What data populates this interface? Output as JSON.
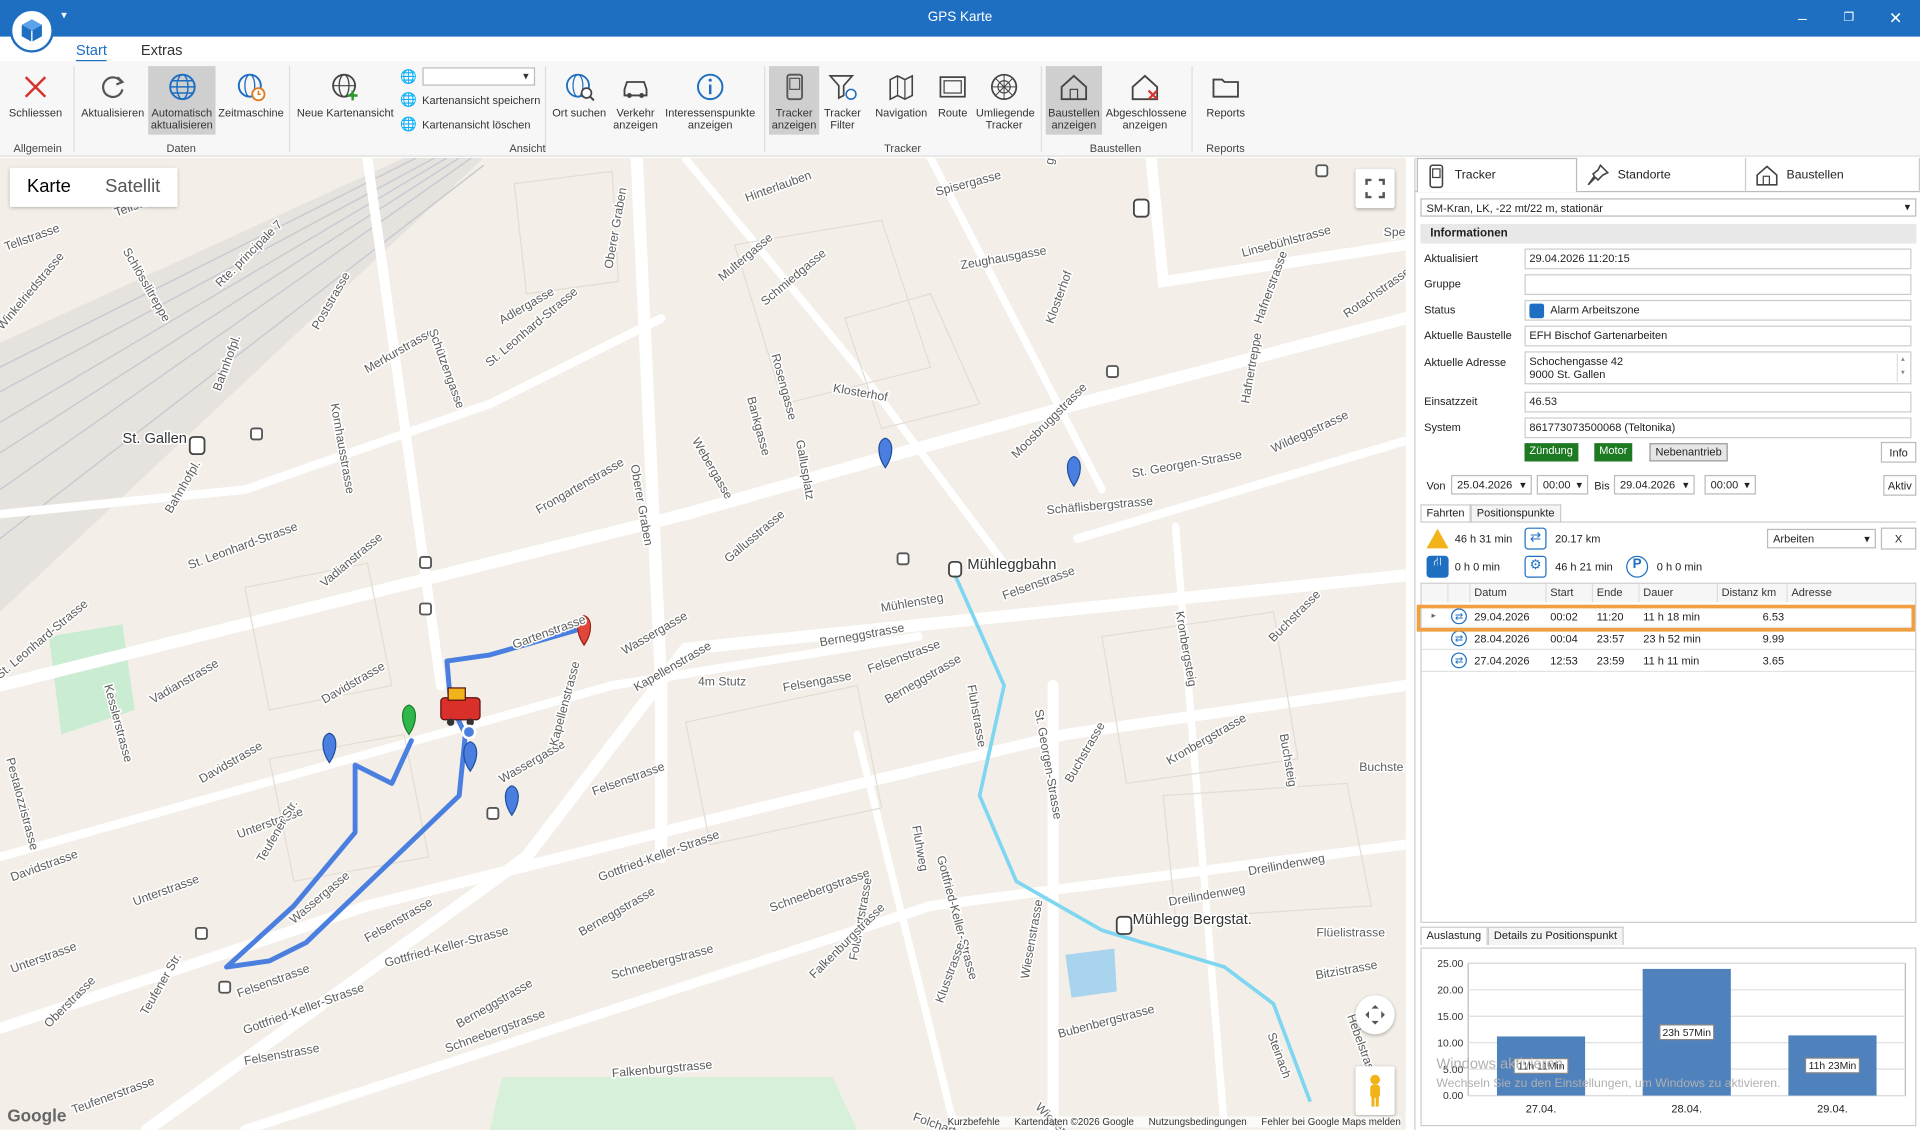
{
  "window": {
    "title": "GPS Karte"
  },
  "ribbon": {
    "tabs": [
      "Start",
      "Extras"
    ],
    "buttons": {
      "schliessen": "Schliessen",
      "aktualisieren": "Aktualisieren",
      "automatisch": "Automatisch aktualisieren",
      "zeitmaschine": "Zeitmaschine",
      "neue_kartenansicht": "Neue Kartenansicht",
      "kartenansicht_speichern": "Kartenansicht speichern",
      "kartenansicht_loeschen": "Kartenansicht löschen",
      "ort_suchen": "Ort suchen",
      "verkehr": "Verkehr anzeigen",
      "interessenspunkte": "Interessenspunkte anzeigen",
      "tracker_anzeigen": "Tracker anzeigen",
      "tracker_filter": "Tracker Filter",
      "navigation": "Navigation",
      "route": "Route",
      "umliegende_tracker": "Umliegende Tracker",
      "baustellen_anzeigen": "Baustellen anzeigen",
      "abgeschlossene": "Abgeschlossene anzeigen",
      "reports": "Reports"
    },
    "groups": {
      "allgemein": "Allgemein",
      "daten": "Daten",
      "ansicht": "Ansicht",
      "tracker": "Tracker",
      "baustellen": "Baustellen",
      "reports": "Reports"
    }
  },
  "map": {
    "toggle": {
      "karte": "Karte",
      "satellit": "Satellit"
    },
    "labels": [
      {
        "t": "Tellstrasse",
        "x": 95,
        "y": 177,
        "r": -20
      },
      {
        "t": "Tellstrasse",
        "x": 5,
        "y": 205,
        "r": -20
      },
      {
        "t": "Winkelriedstrasse",
        "x": 2,
        "y": 270,
        "r": -50
      },
      {
        "t": "Rte. principale 7",
        "x": 180,
        "y": 235,
        "r": -45
      },
      {
        "t": "Schlösslitreppe",
        "x": 100,
        "y": 205,
        "r": 60
      },
      {
        "t": "Poststrasse",
        "x": 260,
        "y": 270,
        "r": -60
      },
      {
        "t": "Kornhausstrasse",
        "x": 270,
        "y": 330,
        "r": 80
      },
      {
        "t": "Merkurstrasse",
        "x": 300,
        "y": 305,
        "r": -30
      },
      {
        "t": "Schützengasse",
        "x": 350,
        "y": 270,
        "r": 70
      },
      {
        "t": "Adlergasse",
        "x": 410,
        "y": 265,
        "r": -30
      },
      {
        "t": "St. Leonhard-Strasse",
        "x": 400,
        "y": 300,
        "r": -40
      },
      {
        "t": "Oberer Graben",
        "x": 500,
        "y": 220,
        "r": -80
      },
      {
        "t": "Hinterlauben",
        "x": 610,
        "y": 165,
        "r": -20
      },
      {
        "t": "Multergasse",
        "x": 590,
        "y": 230,
        "r": -40
      },
      {
        "t": "Schmiedgasse",
        "x": 625,
        "y": 250,
        "r": -40
      },
      {
        "t": "Spisergasse",
        "x": 765,
        "y": 160,
        "r": -15
      },
      {
        "t": "Zeughausgasse",
        "x": 785,
        "y": 220,
        "r": -10
      },
      {
        "t": "Linsebühlstrasse",
        "x": 1015,
        "y": 210,
        "r": -15
      },
      {
        "t": "Hafnerstrasse",
        "x": 1030,
        "y": 265,
        "r": -70
      },
      {
        "t": "Rotachstrasse",
        "x": 1100,
        "y": 260,
        "r": -35
      },
      {
        "t": "Klosterhof",
        "x": 680,
        "y": 320,
        "r": 10
      },
      {
        "t": "Moosbruggstrasse",
        "x": 830,
        "y": 375,
        "r": -45
      },
      {
        "t": "St. Georgen-Strasse",
        "x": 925,
        "y": 390,
        "r": -10
      },
      {
        "t": "Wildeggstrasse",
        "x": 1040,
        "y": 370,
        "r": -25
      },
      {
        "t": "Schäflisbergstrasse",
        "x": 855,
        "y": 420,
        "r": -5
      },
      {
        "t": "St. Gallen",
        "x": 100,
        "y": 362,
        "r": 0
      },
      {
        "t": "Oberer Graben",
        "x": 515,
        "y": 380,
        "r": 80
      },
      {
        "t": "Webergasse",
        "x": 565,
        "y": 360,
        "r": 60
      },
      {
        "t": "Frongartenstrasse",
        "x": 440,
        "y": 420,
        "r": -30
      },
      {
        "t": "Vadianstrasse",
        "x": 265,
        "y": 480,
        "r": -40
      },
      {
        "t": "St. Leonhard-Strasse",
        "x": 155,
        "y": 465,
        "r": -20
      },
      {
        "t": "Gallusstrasse",
        "x": 595,
        "y": 460,
        "r": -40
      },
      {
        "t": "Mühleggbahn",
        "x": 790,
        "y": 465,
        "r": 0
      },
      {
        "t": "Mühlensteg",
        "x": 720,
        "y": 500,
        "r": -10
      },
      {
        "t": "Felsenstrasse",
        "x": 820,
        "y": 490,
        "r": -20
      },
      {
        "t": "Berneggstrasse",
        "x": 670,
        "y": 528,
        "r": -10
      },
      {
        "t": "Wassergasse",
        "x": 510,
        "y": 535,
        "r": -30
      },
      {
        "t": "Gartenstrasse",
        "x": 420,
        "y": 530,
        "r": -20
      },
      {
        "t": "Kapellenstrasse",
        "x": 520,
        "y": 565,
        "r": -30
      },
      {
        "t": "Felsenstrasse",
        "x": 710,
        "y": 550,
        "r": -20
      },
      {
        "t": "Berneggstrasse",
        "x": 725,
        "y": 575,
        "r": -30
      },
      {
        "t": "Davidstrasse",
        "x": 265,
        "y": 575,
        "r": -30
      },
      {
        "t": "Vadianstrasse",
        "x": 125,
        "y": 575,
        "r": -30
      },
      {
        "t": "Kesslerstrasse",
        "x": 85,
        "y": 560,
        "r": 75
      },
      {
        "t": "St. Leonhard-Strasse",
        "x": 0,
        "y": 555,
        "r": -40
      },
      {
        "t": "Davidstrasse",
        "x": 165,
        "y": 640,
        "r": -30
      },
      {
        "t": "Wassergasse",
        "x": 410,
        "y": 640,
        "r": -30
      },
      {
        "t": "Kapellenstrasse",
        "x": 455,
        "y": 610,
        "r": -75
      },
      {
        "t": "Felsenstrasse",
        "x": 485,
        "y": 650,
        "r": -20
      },
      {
        "t": "Fluhstrasse",
        "x": 790,
        "y": 560,
        "r": 80
      },
      {
        "t": "St. Georgen-Strasse",
        "x": 845,
        "y": 580,
        "r": 80
      },
      {
        "t": "Kronbergstrasse",
        "x": 955,
        "y": 625,
        "r": -30
      },
      {
        "t": "Buchstrasse",
        "x": 1040,
        "y": 525,
        "r": -45
      },
      {
        "t": "Buchstrasse",
        "x": 875,
        "y": 640,
        "r": -60
      },
      {
        "t": "Buchste",
        "x": 1110,
        "y": 630,
        "r": 0
      },
      {
        "t": "Unterstrasse",
        "x": 195,
        "y": 685,
        "r": -20
      },
      {
        "t": "Unterstrasse",
        "x": 110,
        "y": 740,
        "r": -20
      },
      {
        "t": "Davidstrasse",
        "x": 10,
        "y": 720,
        "r": -20
      },
      {
        "t": "Teufener Str.",
        "x": 215,
        "y": 705,
        "r": -60
      },
      {
        "t": "Wassergasse",
        "x": 240,
        "y": 755,
        "r": -40
      },
      {
        "t": "Gottfried-Keller-Strasse",
        "x": 490,
        "y": 720,
        "r": -20
      },
      {
        "t": "Berneggstrasse",
        "x": 475,
        "y": 765,
        "r": -30
      },
      {
        "t": "Schneebergstrasse",
        "x": 630,
        "y": 745,
        "r": -20
      },
      {
        "t": "Felsenstrasse",
        "x": 300,
        "y": 770,
        "r": -30
      },
      {
        "t": "Gottfried-Keller-Strasse",
        "x": 315,
        "y": 790,
        "r": -15
      },
      {
        "t": "Gottfried-Keller-Strasse",
        "x": 765,
        "y": 700,
        "r": 75
      },
      {
        "t": "Mühlegg Bergstat.",
        "x": 925,
        "y": 755,
        "r": 0
      },
      {
        "t": "Flüelistrasse",
        "x": 1075,
        "y": 765,
        "r": 0
      },
      {
        "t": "Dreilindenweg",
        "x": 955,
        "y": 740,
        "r": -10
      },
      {
        "t": "Dreilindenweg",
        "x": 1020,
        "y": 715,
        "r": -10
      },
      {
        "t": "Bitzistrasse",
        "x": 1075,
        "y": 800,
        "r": -10
      },
      {
        "t": "Hebelstrasse",
        "x": 1100,
        "y": 830,
        "r": 70
      },
      {
        "t": "Steinach",
        "x": 1035,
        "y": 845,
        "r": 70
      },
      {
        "t": "Wiesenstrasse",
        "x": 840,
        "y": 800,
        "r": -80
      },
      {
        "t": "Bubenbergstrasse",
        "x": 865,
        "y": 848,
        "r": -15
      },
      {
        "t": "Klusstrasse",
        "x": 770,
        "y": 820,
        "r": -70
      },
      {
        "t": "Folchartstrasse",
        "x": 700,
        "y": 785,
        "r": -80
      },
      {
        "t": "Falkenburgstrasse",
        "x": 665,
        "y": 800,
        "r": -45
      },
      {
        "t": "Schneebergstrasse",
        "x": 500,
        "y": 800,
        "r": -15
      },
      {
        "t": "Berneggstrasse",
        "x": 375,
        "y": 840,
        "r": -30
      },
      {
        "t": "Schneebergstrasse",
        "x": 365,
        "y": 860,
        "r": -20
      },
      {
        "t": "Felsenstrasse",
        "x": 195,
        "y": 815,
        "r": -20
      },
      {
        "t": "Gottfried-Keller-Strasse",
        "x": 200,
        "y": 845,
        "r": -20
      },
      {
        "t": "Oberstrasse",
        "x": 40,
        "y": 840,
        "r": -45
      },
      {
        "t": "Unterstrasse",
        "x": 10,
        "y": 795,
        "r": -20
      },
      {
        "t": "Teufener Str.",
        "x": 120,
        "y": 830,
        "r": -60
      },
      {
        "t": "Falkenburgstrasse",
        "x": 500,
        "y": 880,
        "r": -5
      },
      {
        "t": "Wiesenstrasse",
        "x": 845,
        "y": 905,
        "r": 45
      },
      {
        "t": "Folchartstr.",
        "x": 745,
        "y": 915,
        "r": 20
      },
      {
        "t": "Teufenerstrasse",
        "x": 60,
        "y": 910,
        "r": -20
      },
      {
        "t": "Felsenstrasse",
        "x": 200,
        "y": 870,
        "r": -10
      },
      {
        "t": "Pestalozzistrasse",
        "x": 5,
        "y": 620,
        "r": 75
      },
      {
        "t": "Bahnhofpl.",
        "x": 180,
        "y": 320,
        "r": -70
      },
      {
        "t": "Bahnhofpl.",
        "x": 140,
        "y": 420,
        "r": -60
      },
      {
        "t": "Bankgasse",
        "x": 610,
        "y": 325,
        "r": 75
      },
      {
        "t": "Gallusplatz",
        "x": 650,
        "y": 360,
        "r": 80
      },
      {
        "t": "Rosengasse",
        "x": 630,
        "y": 290,
        "r": 75
      },
      {
        "t": "Klosterhof",
        "x": 860,
        "y": 265,
        "r": -70
      },
      {
        "t": "Kronbergsteig",
        "x": 960,
        "y": 500,
        "r": 80
      },
      {
        "t": "Hafnertreppe",
        "x": 1020,
        "y": 330,
        "r": -80
      },
      {
        "t": "Fluhweg",
        "x": 745,
        "y": 675,
        "r": 80
      },
      {
        "t": "Buchsteig",
        "x": 1045,
        "y": 600,
        "r": 80
      },
      {
        "t": "4m Stutz",
        "x": 570,
        "y": 560,
        "r": 0
      },
      {
        "t": "Felsengasse",
        "x": 640,
        "y": 565,
        "r": -10
      },
      {
        "t": "Spe",
        "x": 1130,
        "y": 193,
        "r": 0
      },
      {
        "t": "gasse",
        "x": 860,
        "y": 135,
        "r": -80
      }
    ],
    "footer": [
      "Kurzbefehle",
      "Kartendaten ©2026 Google",
      "Nutzungsbedingungen",
      "Fehler bei Google Maps melden"
    ],
    "google": "Google"
  },
  "panel": {
    "tabs": [
      "Tracker",
      "Standorte",
      "Baustellen"
    ],
    "tracker_select": "SM-Kran, LK, -22 mt/22 m, stationär",
    "info_header": "Informationen",
    "fields": [
      {
        "label": "Aktualisiert",
        "value": "29.04.2026 11:20:15"
      },
      {
        "label": "Gruppe",
        "value": ""
      },
      {
        "label": "Status",
        "value": "Alarm Arbeitszone"
      },
      {
        "label": "Aktuelle Baustelle",
        "value": "EFH Bischof Gartenarbeiten"
      },
      {
        "label": "Aktuelle Adresse",
        "value": "Schochengasse 42",
        "value2": "9000 St. Gallen"
      },
      {
        "label": "Einsatzzeit",
        "value": "46.53"
      },
      {
        "label": "System",
        "value": "861773073500068 (Teltonika)"
      }
    ],
    "badges": [
      "Zündung",
      "Motor",
      "Nebenantrieb"
    ],
    "info_button": "Info",
    "von_label": "Von",
    "von_date": "25.04.2026",
    "von_time": "00:00",
    "bis_label": "Bis",
    "bis_date": "29.04.2026",
    "bis_time": "00:00",
    "aktiv": "Aktiv",
    "subtabs": [
      "Fahrten",
      "Positionspunkte"
    ],
    "summary": {
      "s1": "46 h 31 min",
      "s2": "20.17 km",
      "s3": "0 h 0 min",
      "s4": "46 h 21 min",
      "s5": "0 h 0 min"
    },
    "filter": "Arbeiten",
    "clear": "X",
    "table": {
      "headers": [
        "Datum",
        "Start",
        "Ende",
        "Dauer",
        "Distanz km",
        "Adresse"
      ],
      "rows": [
        {
          "datum": "29.04.2026",
          "start": "00:02",
          "ende": "11:20",
          "dauer": "11 h 18 min",
          "distanz": "6.53"
        },
        {
          "datum": "28.04.2026",
          "start": "00:04",
          "ende": "23:57",
          "dauer": "23 h 52 min",
          "distanz": "9.99"
        },
        {
          "datum": "27.04.2026",
          "start": "12:53",
          "ende": "23:59",
          "dauer": "11 h 11 min",
          "distanz": "3.65"
        }
      ]
    },
    "bottom_tabs": [
      "Auslastung",
      "Details zu Positionspunkt"
    ],
    "watermark1": "Windows aktivieren",
    "watermark2": "Wechseln Sie zu den Einstellungen, um Windows zu aktivieren."
  },
  "chart_data": {
    "type": "bar",
    "categories": [
      "27.04.",
      "28.04.",
      "29.04."
    ],
    "values": [
      11.18,
      23.95,
      11.38
    ],
    "data_labels": [
      "11h 11Min",
      "23h 57Min",
      "11h 23Min"
    ],
    "yticks": [
      "0.00",
      "5.00",
      "10.00",
      "15.00",
      "20.00",
      "25.00"
    ],
    "ylim": [
      0,
      25
    ],
    "bar_color": "#4f81bd"
  }
}
